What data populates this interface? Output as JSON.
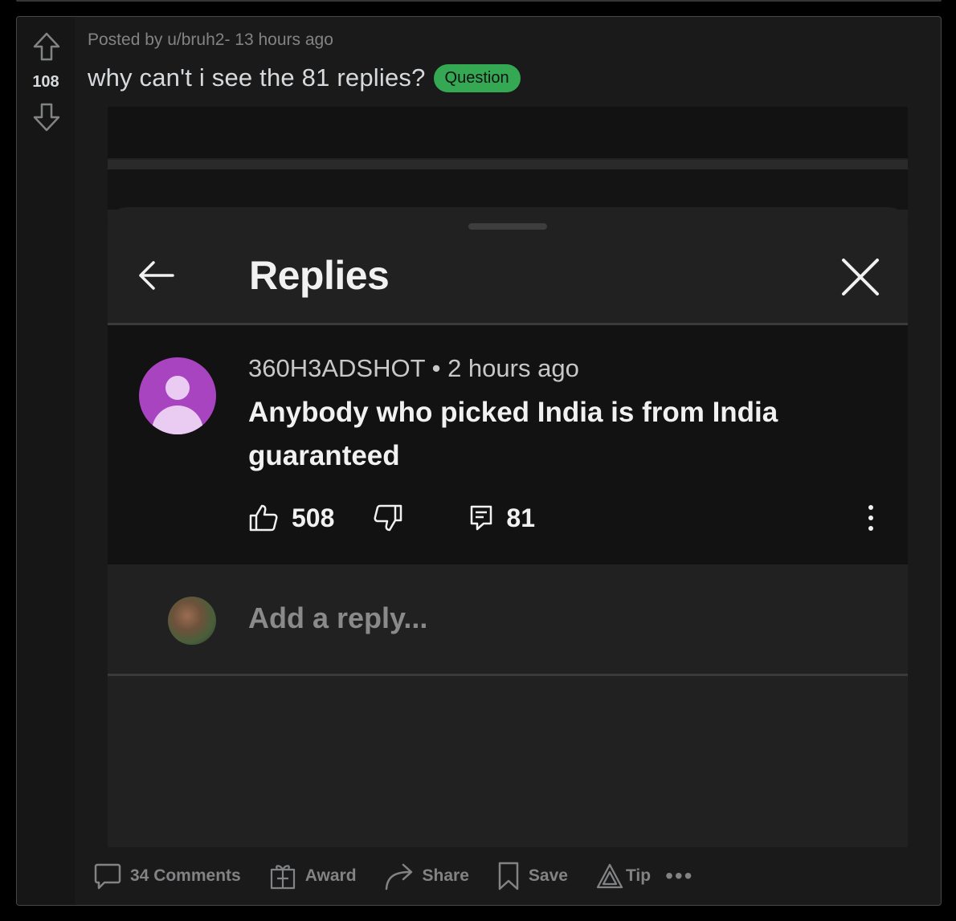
{
  "post": {
    "score": "108",
    "posted_by": "Posted by u/bruh2- 13 hours ago",
    "title": "why can't i see the 81 replies?",
    "flair": "Question"
  },
  "embedded": {
    "header_title": "Replies",
    "comment": {
      "author": "360H3ADSHOT",
      "separator": "•",
      "time": "2 hours ago",
      "text": "Anybody who picked India is from India guaranteed",
      "likes": "508",
      "replies": "81"
    },
    "reply_placeholder": "Add a reply...",
    "colors": {
      "avatar": "#a944c1",
      "background": "#212121"
    }
  },
  "footer": {
    "comments": "34 Comments",
    "award": "Award",
    "share": "Share",
    "save": "Save",
    "tip": "Tip",
    "more": "•••"
  },
  "colors": {
    "flair": "#34a853",
    "card": "#1a1a1b",
    "muted": "#818384"
  }
}
